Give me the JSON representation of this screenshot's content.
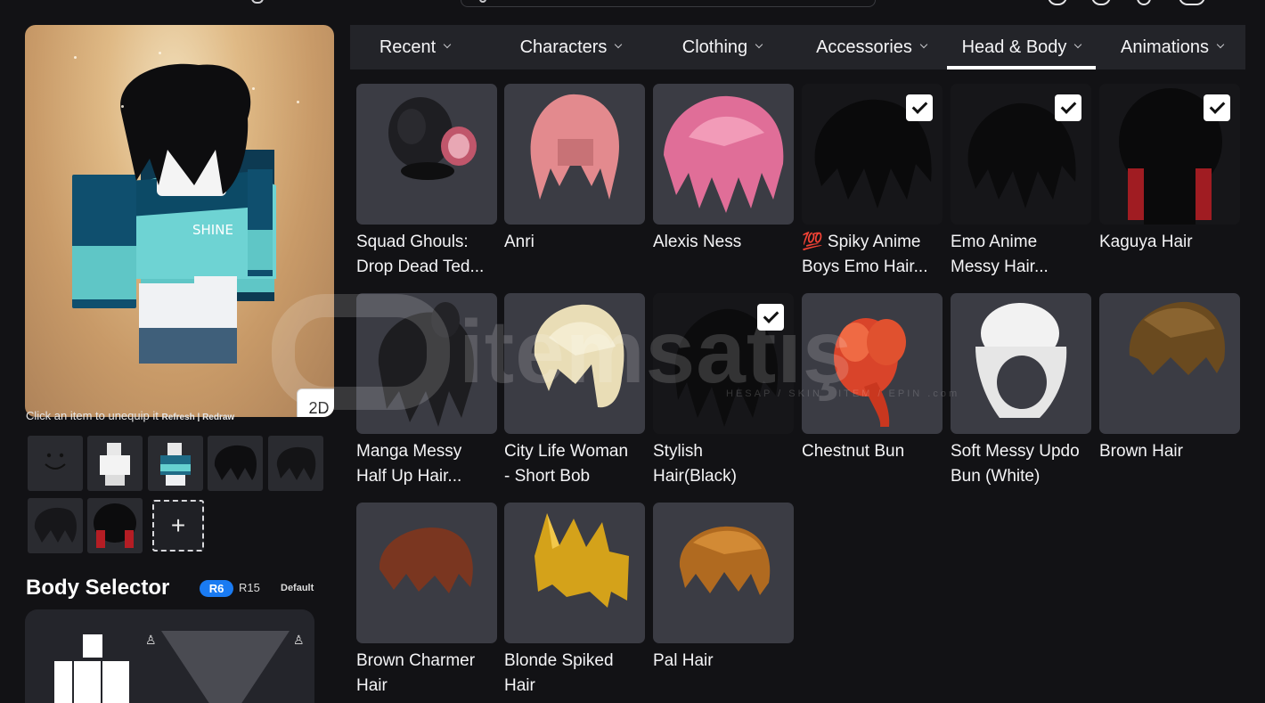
{
  "top_bar": {
    "search_placeholder": ""
  },
  "preview": {
    "mode_button": "2D",
    "hint_text": "Click an item to unequip it",
    "hint_links": "Refresh | Redraw"
  },
  "body_selector": {
    "title": "Body Selector",
    "r6": "R6",
    "r15": "R15",
    "default": "Default",
    "selected_rig": "R6"
  },
  "tabs": [
    {
      "label": "Recent",
      "active": false
    },
    {
      "label": "Characters",
      "active": false
    },
    {
      "label": "Clothing",
      "active": false
    },
    {
      "label": "Accessories",
      "active": false
    },
    {
      "label": "Head & Body",
      "active": true
    },
    {
      "label": "Animations",
      "active": false
    }
  ],
  "items": [
    {
      "name_line1": "Squad Ghouls:",
      "name_line2": "Drop Dead Ted...",
      "equipped": false
    },
    {
      "name_line1": "Anri",
      "name_line2": "",
      "equipped": false
    },
    {
      "name_line1": "Alexis Ness",
      "name_line2": "",
      "equipped": false
    },
    {
      "name_line1": "💯 Spiky Anime",
      "name_line2": "Boys Emo Hair...",
      "equipped": true
    },
    {
      "name_line1": "Emo Anime",
      "name_line2": "Messy Hair...",
      "equipped": true
    },
    {
      "name_line1": "Kaguya Hair",
      "name_line2": "",
      "equipped": true
    },
    {
      "name_line1": "Manga Messy",
      "name_line2": "Half Up Hair...",
      "equipped": false
    },
    {
      "name_line1": "City Life Woman",
      "name_line2": "- Short Bob",
      "equipped": false
    },
    {
      "name_line1": "Stylish",
      "name_line2": "Hair(Black)",
      "equipped": true
    },
    {
      "name_line1": "Chestnut Bun",
      "name_line2": "",
      "equipped": false
    },
    {
      "name_line1": "Soft Messy Updo",
      "name_line2": "Bun (White)",
      "equipped": false
    },
    {
      "name_line1": "Brown Hair",
      "name_line2": "",
      "equipped": false
    },
    {
      "name_line1": "Brown Charmer",
      "name_line2": "Hair",
      "equipped": false
    },
    {
      "name_line1": "Blonde Spiked",
      "name_line2": "Hair",
      "equipped": false
    },
    {
      "name_line1": "Pal Hair",
      "name_line2": "",
      "equipped": false
    }
  ],
  "equipped_slots": [
    {
      "icon": "face-smile-icon"
    },
    {
      "icon": "avatar-white-icon"
    },
    {
      "icon": "avatar-outfit-icon"
    },
    {
      "icon": "black-hair-icon"
    },
    {
      "icon": "black-hair-icon"
    },
    {
      "icon": "black-hair-icon"
    },
    {
      "icon": "black-red-hair-icon"
    }
  ],
  "watermark": {
    "text": "itemsatış",
    "subtext": "HESAP / SKIN / ITEM / EPIN",
    "suffix": ".com"
  },
  "colors": {
    "background": "#121215",
    "tab_bar": "#232429",
    "card": "#3b3c44",
    "accent_blue": "#1a7bf2"
  }
}
